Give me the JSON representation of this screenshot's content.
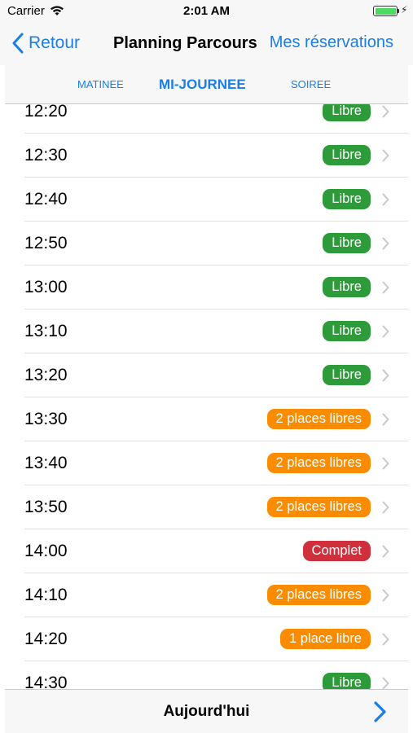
{
  "status_bar": {
    "carrier": "Carrier",
    "time": "2:01 AM",
    "battery_level": 1.0,
    "battery_color": "#4cd964"
  },
  "nav": {
    "back_label": "Retour",
    "title": "Planning Parcours",
    "reservations_label": "Mes réservations"
  },
  "tabs": [
    {
      "label": "MATINEE",
      "selected": false
    },
    {
      "label": "MI-JOURNEE",
      "selected": true
    },
    {
      "label": "SOIREE",
      "selected": false
    }
  ],
  "slots": [
    {
      "time": "12:20",
      "status": "Libre",
      "kind": "free"
    },
    {
      "time": "12:30",
      "status": "Libre",
      "kind": "free"
    },
    {
      "time": "12:40",
      "status": "Libre",
      "kind": "free"
    },
    {
      "time": "12:50",
      "status": "Libre",
      "kind": "free"
    },
    {
      "time": "13:00",
      "status": "Libre",
      "kind": "free"
    },
    {
      "time": "13:10",
      "status": "Libre",
      "kind": "free"
    },
    {
      "time": "13:20",
      "status": "Libre",
      "kind": "free"
    },
    {
      "time": "13:30",
      "status": "2 places libres",
      "kind": "partial"
    },
    {
      "time": "13:40",
      "status": "2 places libres",
      "kind": "partial"
    },
    {
      "time": "13:50",
      "status": "2 places libres",
      "kind": "partial"
    },
    {
      "time": "14:00",
      "status": "Complet",
      "kind": "full"
    },
    {
      "time": "14:10",
      "status": "2 places libres",
      "kind": "partial"
    },
    {
      "time": "14:20",
      "status": "1 place libre",
      "kind": "partial"
    },
    {
      "time": "14:30",
      "status": "Libre",
      "kind": "free"
    }
  ],
  "bottom": {
    "today_label": "Aujourd'hui"
  },
  "colors": {
    "accent": "#1a7ee8",
    "free": "#2e9b3a",
    "partial": "#fb8c00",
    "full": "#d0303b"
  },
  "icons": {
    "back": "chevron-left-icon",
    "row": "chevron-right-icon",
    "next_day": "chevron-right-icon",
    "wifi": "wifi-icon",
    "battery": "battery-icon"
  }
}
